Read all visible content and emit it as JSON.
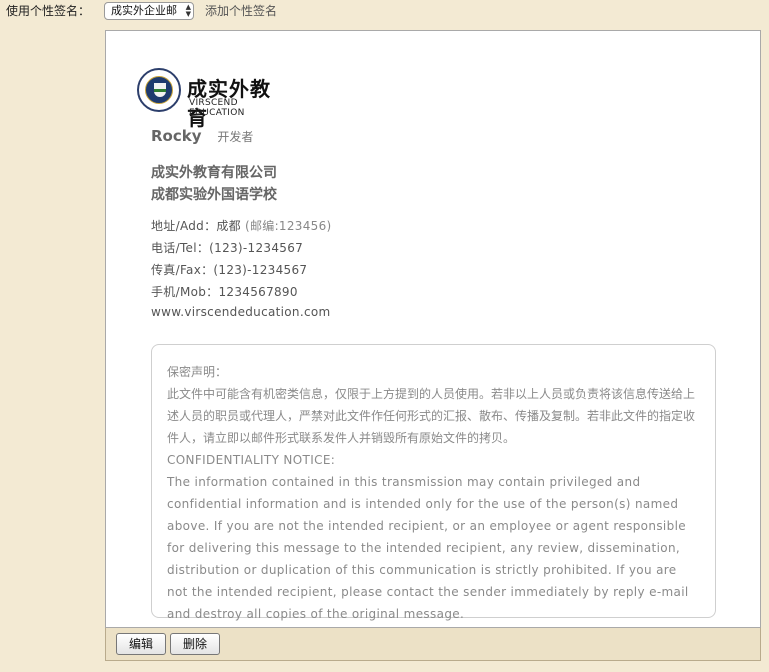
{
  "top": {
    "label": "使用个性签名：",
    "select_value": "成实外企业邮",
    "add_link": "添加个性签名"
  },
  "signature": {
    "logo_cn": "成实外教育",
    "logo_en": "VIRSCEND EDUCATION",
    "name": "Rocky",
    "title": "开发者",
    "company_1": "成实外教育有限公司",
    "company_2": "成都实验外国语学校",
    "address": "地址/Add：成都",
    "zip": "(邮编:123456)",
    "tel": "电话/Tel：(123)-1234567",
    "fax": "传真/Fax：(123)-1234567",
    "mobile": "手机/Mob：1234567890",
    "website": "www.virscendeducation.com"
  },
  "notice": {
    "heading_cn": "保密声明：",
    "body_cn": "此文件中可能含有机密类信息，仅限于上方提到的人员使用。若非以上人员或负责将该信息传送给上述人员的职员或代理人，严禁对此文件作任何形式的汇报、散布、传播及复制。若非此文件的指定收件人，请立即以邮件形式联系发件人并销毁所有原始文件的拷贝。",
    "heading_en": "CONFIDENTIALITY NOTICE:",
    "body_en": "The information contained in this transmission may contain privileged and confidential information and is intended only for the use of the person(s) named above. If you are not the intended recipient, or an employee or agent responsible for delivering this message to the intended recipient, any review, dissemination, distribution or duplication of this communication is strictly prohibited. If you are not the intended recipient, please contact the sender immediately by reply e-mail and destroy all copies of the original message."
  },
  "actions": {
    "edit": "编辑",
    "delete": "删除"
  }
}
